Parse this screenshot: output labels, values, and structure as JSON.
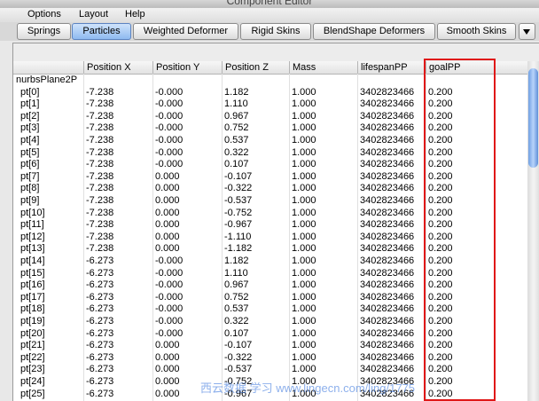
{
  "window": {
    "title": "Component Editor"
  },
  "menu": [
    "Options",
    "Layout",
    "Help"
  ],
  "tabs": [
    {
      "label": "Springs",
      "active": false
    },
    {
      "label": "Particles",
      "active": true
    },
    {
      "label": "Weighted Deformer",
      "active": false
    },
    {
      "label": "Rigid Skins",
      "active": false
    },
    {
      "label": "BlendShape Deformers",
      "active": false
    },
    {
      "label": "Smooth Skins",
      "active": false
    }
  ],
  "table": {
    "columns": [
      "",
      "Position X",
      "Position Y",
      "Position Z",
      "Mass",
      "lifespanPP",
      "goalPP"
    ],
    "group": "nurbsPlane2P",
    "rows": [
      [
        "pt[0]",
        "-7.238",
        "-0.000",
        "1.182",
        "1.000",
        "3402823466",
        "0.200"
      ],
      [
        "pt[1]",
        "-7.238",
        "-0.000",
        "1.110",
        "1.000",
        "3402823466",
        "0.200"
      ],
      [
        "pt[2]",
        "-7.238",
        "-0.000",
        "0.967",
        "1.000",
        "3402823466",
        "0.200"
      ],
      [
        "pt[3]",
        "-7.238",
        "-0.000",
        "0.752",
        "1.000",
        "3402823466",
        "0.200"
      ],
      [
        "pt[4]",
        "-7.238",
        "-0.000",
        "0.537",
        "1.000",
        "3402823466",
        "0.200"
      ],
      [
        "pt[5]",
        "-7.238",
        "-0.000",
        "0.322",
        "1.000",
        "3402823466",
        "0.200"
      ],
      [
        "pt[6]",
        "-7.238",
        "-0.000",
        "0.107",
        "1.000",
        "3402823466",
        "0.200"
      ],
      [
        "pt[7]",
        "-7.238",
        "0.000",
        "-0.107",
        "1.000",
        "3402823466",
        "0.200"
      ],
      [
        "pt[8]",
        "-7.238",
        "0.000",
        "-0.322",
        "1.000",
        "3402823466",
        "0.200"
      ],
      [
        "pt[9]",
        "-7.238",
        "0.000",
        "-0.537",
        "1.000",
        "3402823466",
        "0.200"
      ],
      [
        "pt[10]",
        "-7.238",
        "0.000",
        "-0.752",
        "1.000",
        "3402823466",
        "0.200"
      ],
      [
        "pt[11]",
        "-7.238",
        "0.000",
        "-0.967",
        "1.000",
        "3402823466",
        "0.200"
      ],
      [
        "pt[12]",
        "-7.238",
        "0.000",
        "-1.110",
        "1.000",
        "3402823466",
        "0.200"
      ],
      [
        "pt[13]",
        "-7.238",
        "0.000",
        "-1.182",
        "1.000",
        "3402823466",
        "0.200"
      ],
      [
        "pt[14]",
        "-6.273",
        "-0.000",
        "1.182",
        "1.000",
        "3402823466",
        "0.200"
      ],
      [
        "pt[15]",
        "-6.273",
        "-0.000",
        "1.110",
        "1.000",
        "3402823466",
        "0.200"
      ],
      [
        "pt[16]",
        "-6.273",
        "-0.000",
        "0.967",
        "1.000",
        "3402823466",
        "0.200"
      ],
      [
        "pt[17]",
        "-6.273",
        "-0.000",
        "0.752",
        "1.000",
        "3402823466",
        "0.200"
      ],
      [
        "pt[18]",
        "-6.273",
        "-0.000",
        "0.537",
        "1.000",
        "3402823466",
        "0.200"
      ],
      [
        "pt[19]",
        "-6.273",
        "-0.000",
        "0.322",
        "1.000",
        "3402823466",
        "0.200"
      ],
      [
        "pt[20]",
        "-6.273",
        "-0.000",
        "0.107",
        "1.000",
        "3402823466",
        "0.200"
      ],
      [
        "pt[21]",
        "-6.273",
        "0.000",
        "-0.107",
        "1.000",
        "3402823466",
        "0.200"
      ],
      [
        "pt[22]",
        "-6.273",
        "0.000",
        "-0.322",
        "1.000",
        "3402823466",
        "0.200"
      ],
      [
        "pt[23]",
        "-6.273",
        "0.000",
        "-0.537",
        "1.000",
        "3402823466",
        "0.200"
      ],
      [
        "pt[24]",
        "-6.273",
        "0.000",
        "-0.752",
        "1.000",
        "3402823466",
        "0.200"
      ],
      [
        "pt[25]",
        "-6.273",
        "0.000",
        "-0.967",
        "1.000",
        "3402823466",
        "0.200"
      ]
    ]
  },
  "watermark": "西云数据 学习 www.lingecn.com/ling/1775",
  "colors": {
    "highlight": "#e01818",
    "active_tab": "#8fbaf0"
  }
}
